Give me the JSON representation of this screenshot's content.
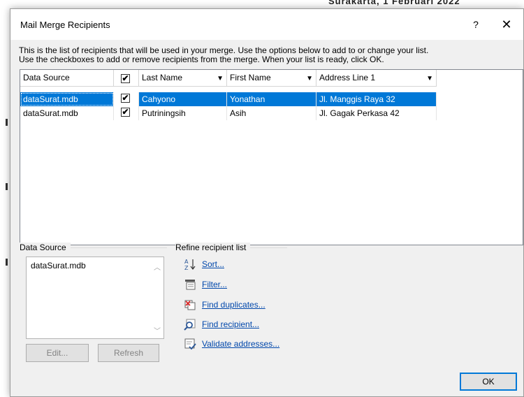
{
  "dialog": {
    "title": "Mail Merge Recipients",
    "help_label": "?",
    "close_label": "✕",
    "instructions_line1": "This is the list of recipients that will be used in your merge.  Use the options below to add to or change your list.",
    "instructions_line2": "Use the checkboxes to add or remove recipients from the merge.  When your list is ready, click OK."
  },
  "grid": {
    "headers": {
      "data_source": "Data Source",
      "last_name": "Last Name",
      "first_name": "First Name",
      "address_line1": "Address Line 1"
    },
    "rows": [
      {
        "data_source": "dataSurat.mdb",
        "checked": "✔",
        "last_name": "Cahyono",
        "first_name": "Yonathan",
        "address": "Jl. Manggis Raya 32",
        "selected": true
      },
      {
        "data_source": "dataSurat.mdb",
        "checked": "✔",
        "last_name": "Putriningsih",
        "first_name": "Asih",
        "address": "Jl. Gagak Perkasa 42",
        "selected": false
      }
    ],
    "header_check": "✔"
  },
  "data_source_group": {
    "label": "Data Source",
    "items": [
      "dataSurat.mdb"
    ],
    "edit_label": "Edit...",
    "refresh_label": "Refresh"
  },
  "refine_group": {
    "label": "Refine recipient list",
    "sort": "Sort...",
    "filter": "Filter...",
    "find_duplicates": "Find duplicates...",
    "find_recipient": "Find recipient...",
    "validate_addresses": "Validate addresses..."
  },
  "ok_label": "OK",
  "colors": {
    "selection": "#0078d7",
    "link": "#0047ab",
    "dialog_bg": "#f0f0f0"
  }
}
